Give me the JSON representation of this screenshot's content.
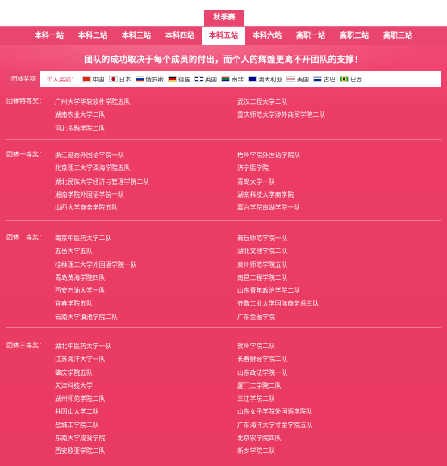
{
  "season_tab": "秋季赛",
  "nav": [
    "本科一站",
    "本科二站",
    "本科三站",
    "本科四站",
    "本科五站",
    "本科六站",
    "高职一站",
    "高职二站",
    "高职三站"
  ],
  "nav_active_index": 4,
  "slogan": "团队的成功取决于每个成员的付出，而个人的辉煌更离不开团队的支撑！",
  "filter": {
    "team_label": "团体奖项",
    "individual_label": "个人奖项：",
    "countries": [
      {
        "name": "中国",
        "flag": "china-flag-icon"
      },
      {
        "name": "日本",
        "flag": "japan-flag-icon"
      },
      {
        "name": "俄罗斯",
        "flag": "russia-flag-icon"
      },
      {
        "name": "德国",
        "flag": "germany-flag-icon"
      },
      {
        "name": "英国",
        "flag": "uk-flag-icon"
      },
      {
        "name": "南非",
        "flag": "south-africa-flag-icon"
      },
      {
        "name": "澳大利亚",
        "flag": "australia-flag-icon"
      },
      {
        "name": "美国",
        "flag": "usa-flag-icon"
      },
      {
        "name": "古巴",
        "flag": "cuba-flag-icon"
      },
      {
        "name": "巴西",
        "flag": "brazil-flag-icon"
      }
    ]
  },
  "sections": [
    {
      "title": "团体特等奖：",
      "left": [
        "广州大学华软软件学院五队",
        "湖南农业大学二队",
        "河北金融学院二队"
      ],
      "right": [
        "武汉工程大学二队",
        "重庆师范大学涉外商贸学院二队"
      ]
    },
    {
      "title": "团体一等奖：",
      "left": [
        "浙江越秀外国语学院一队",
        "北京理工大学珠海学院五队",
        "湖北民族大学经济与管理学院二队",
        "湘南学院外国语学院一队",
        "山西大学商务学院五队"
      ],
      "right": [
        "梧州学院外国语学院队",
        "济宁医学院",
        "青岛大学一队",
        "湖南科技大学商学院",
        "嘉兴学院南湖学院一队"
      ]
    },
    {
      "title": "团体二等奖：",
      "left": [
        "南京中医药大学二队",
        "五邑大学五队",
        "桂林理工大学外国语学院一队",
        "青岛黄海学院四队",
        "西安石油大学一队",
        "宜春学院五队",
        "云南大学滇池学院二队"
      ],
      "right": [
        "商丘师范学院一队",
        "湖北文理学院二队",
        "泉州师范学院五队",
        "南昌工程学院二队",
        "山东青年政治学院二队",
        "齐鲁工业大学国际商务系三队",
        "广东金融学院"
      ]
    },
    {
      "title": "团体三等奖：",
      "left": [
        "湖北中医药大学一队",
        "江苏海洋大学一队",
        "肇庆学院五队",
        "天津科技大学",
        "湖州师范学院二队",
        "井冈山大学二队",
        "盐城工学院二队",
        "东南大学成贤学院",
        "西安欧亚学院二队"
      ],
      "right": [
        "贺州学院二队",
        "长春财经学院二队",
        "山东政法学院一队",
        "厦门工学院二队",
        "三江学院二队",
        "山东女子学院外国语学院队",
        "广东海洋大学寸金学院五队",
        "北京农学院四队",
        "新乡学院二队"
      ]
    }
  ],
  "colors": {
    "accent": "#e8466e",
    "background": "#e93a61",
    "text": "#ffffff"
  }
}
